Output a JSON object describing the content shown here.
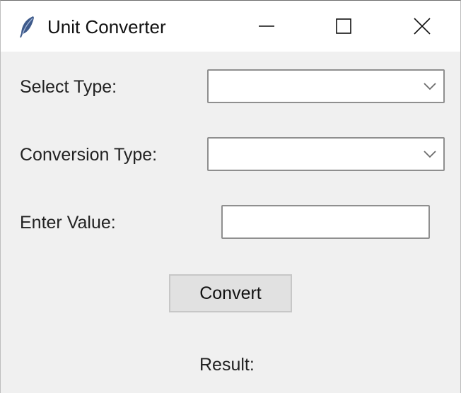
{
  "window": {
    "title": "Unit Converter",
    "app_icon": "feather-icon",
    "controls": {
      "minimize_icon": "minimize-icon",
      "maximize_icon": "maximize-icon",
      "close_icon": "close-icon"
    }
  },
  "form": {
    "select_type": {
      "label": "Select Type:",
      "value": ""
    },
    "conversion_type": {
      "label": "Conversion Type:",
      "value": ""
    },
    "enter_value": {
      "label": "Enter Value:",
      "value": "",
      "placeholder": ""
    },
    "convert_button_label": "Convert",
    "result_label": "Result:"
  },
  "colors": {
    "window_bg": "#f0f0f0",
    "titlebar_bg": "#ffffff",
    "button_bg": "#e1e1e1",
    "field_border": "#8f8f8f"
  }
}
